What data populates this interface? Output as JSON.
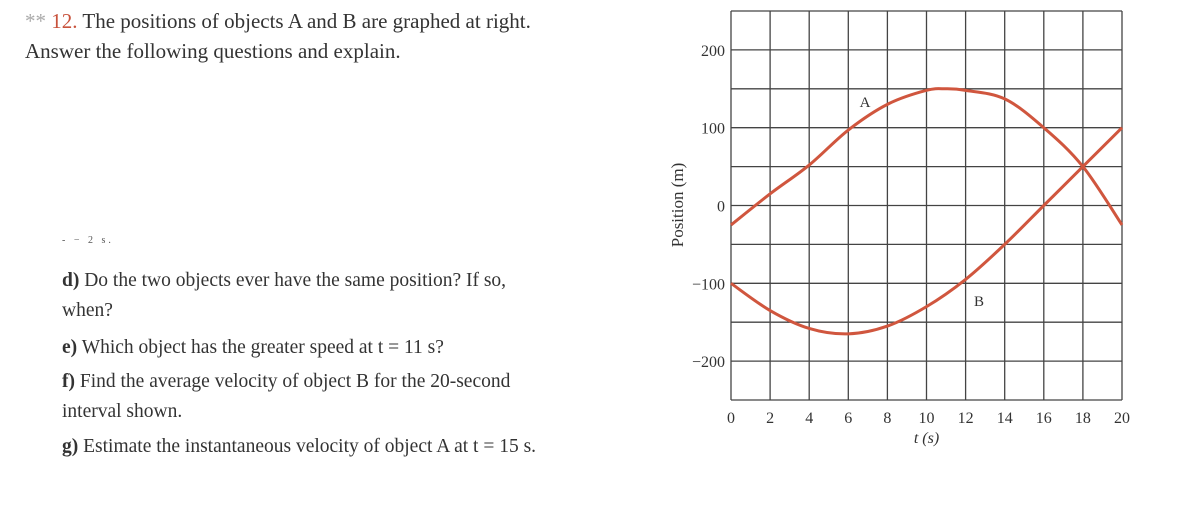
{
  "problem": {
    "stars": "**",
    "number": "12.",
    "line1": "The positions of objects A and B are graphed at right.",
    "line2": "Answer the following questions and explain.",
    "cut_fragment": "- − 2 s.",
    "parts": [
      {
        "label": "d)",
        "lines": [
          "Do the two objects ever have the same position? If so,",
          "when?"
        ]
      },
      {
        "label": "e)",
        "lines": [
          "Which object has the greater speed at t = 11 s?"
        ]
      },
      {
        "label": "f)",
        "lines": [
          "Find the average velocity of object B for the 20-second",
          "interval shown."
        ]
      },
      {
        "label": "g)",
        "lines": [
          "Estimate the instantaneous velocity of object A at t = 15 s."
        ]
      }
    ]
  },
  "chart_data": {
    "type": "line",
    "title": "",
    "xlabel": "t (s)",
    "ylabel": "Position (m)",
    "xlim": [
      0,
      20
    ],
    "ylim": [
      -250,
      250
    ],
    "xticks": [
      0,
      2,
      4,
      6,
      8,
      10,
      12,
      14,
      16,
      18,
      20
    ],
    "yticks": [
      200,
      100,
      0,
      -100,
      -200
    ],
    "grid": true,
    "grid_y_step": 50,
    "line_color": "#d0563e",
    "series": [
      {
        "name": "A",
        "x": [
          0,
          2,
          4,
          6,
          8,
          10,
          11,
          12,
          14,
          16,
          18,
          20
        ],
        "y": [
          -25,
          15,
          52,
          97,
          130,
          148,
          150,
          148,
          137,
          100,
          50,
          -25
        ]
      },
      {
        "name": "B",
        "x": [
          0,
          2,
          4,
          6,
          8,
          10,
          12,
          14,
          16,
          18,
          20
        ],
        "y": [
          -100,
          -135,
          -158,
          -165,
          -155,
          -130,
          -95,
          -50,
          0,
          50,
          100
        ]
      }
    ]
  }
}
